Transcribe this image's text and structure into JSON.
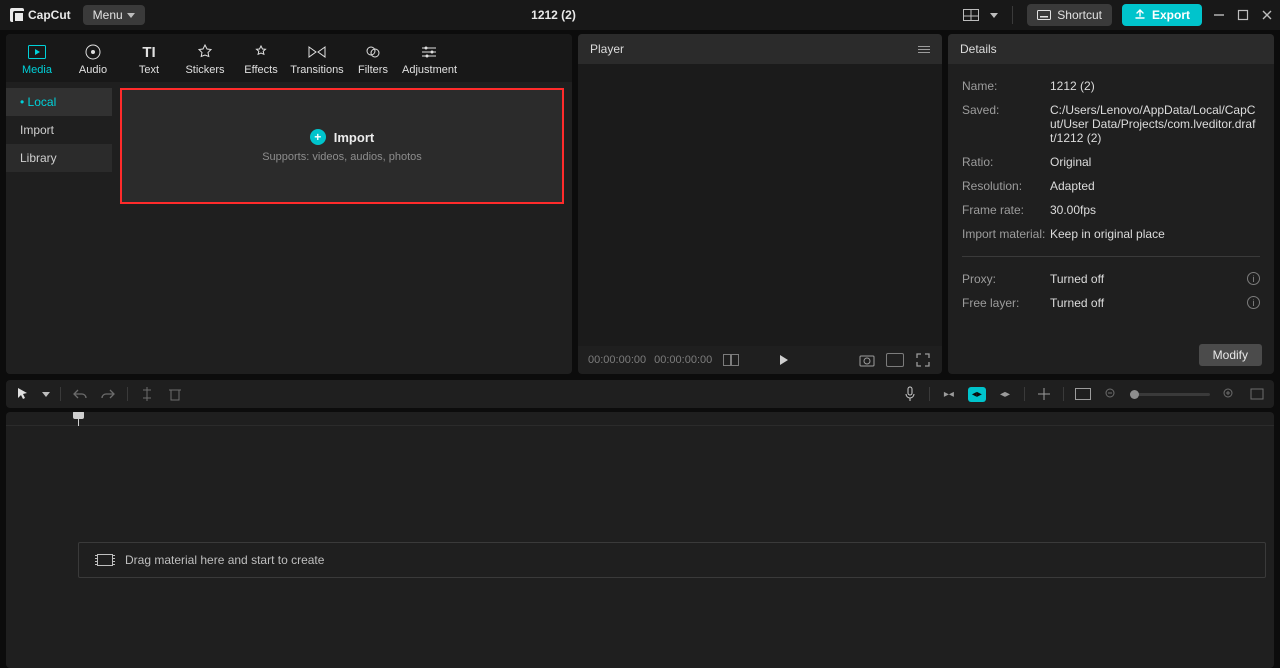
{
  "app": {
    "name": "CapCut",
    "menu_label": "Menu"
  },
  "project_title": "1212 (2)",
  "titlebar": {
    "shortcut_label": "Shortcut",
    "export_label": "Export"
  },
  "media_tabs": [
    {
      "label": "Media",
      "icon": "film"
    },
    {
      "label": "Audio",
      "icon": "audio"
    },
    {
      "label": "Text",
      "icon": "text"
    },
    {
      "label": "Stickers",
      "icon": "sticker"
    },
    {
      "label": "Effects",
      "icon": "effects"
    },
    {
      "label": "Transitions",
      "icon": "transitions"
    },
    {
      "label": "Filters",
      "icon": "filters"
    },
    {
      "label": "Adjustment",
      "icon": "adjustment"
    }
  ],
  "media_side": {
    "local": "Local",
    "import": "Import",
    "library": "Library"
  },
  "import_drop": {
    "title": "Import",
    "subtitle": "Supports: videos, audios, photos"
  },
  "player": {
    "title": "Player",
    "time_current": "00:00:00:00",
    "time_total": "00:00:00:00"
  },
  "details": {
    "title": "Details",
    "rows": {
      "name": {
        "label": "Name:",
        "value": "1212 (2)"
      },
      "saved": {
        "label": "Saved:",
        "value": "C:/Users/Lenovo/AppData/Local/CapCut/User Data/Projects/com.lveditor.draft/1212 (2)"
      },
      "ratio": {
        "label": "Ratio:",
        "value": "Original"
      },
      "resolution": {
        "label": "Resolution:",
        "value": "Adapted"
      },
      "frame_rate": {
        "label": "Frame rate:",
        "value": "30.00fps"
      },
      "import_material": {
        "label": "Import material:",
        "value": "Keep in original place"
      },
      "proxy": {
        "label": "Proxy:",
        "value": "Turned off"
      },
      "free_layer": {
        "label": "Free layer:",
        "value": "Turned off"
      }
    },
    "modify_label": "Modify"
  },
  "timeline": {
    "drag_hint": "Drag material here and start to create"
  },
  "colors": {
    "accent": "#00c4cc",
    "highlight_border": "#ff2b2b"
  }
}
